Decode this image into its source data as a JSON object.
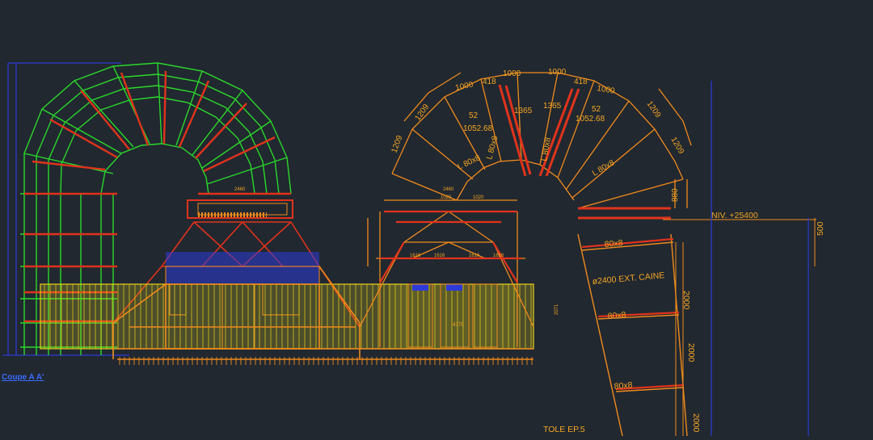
{
  "drawing": {
    "section_label": "Coupe A A'",
    "left_dims": [
      "880",
      "1209",
      "1209",
      "1000",
      "418",
      "1000",
      "1000",
      "418",
      "1000",
      "52",
      "1052.68",
      "1365",
      "1365",
      "52",
      "1052.68",
      "L 80x8",
      "L 80x8",
      "L 80x8",
      "L 80x8"
    ],
    "level_label": "NIV. +25400",
    "duct_labels": [
      "80x8",
      "ø2400 EXT. CAINE",
      "80x8",
      "80x8"
    ],
    "vertical_dims": [
      "500",
      "2000",
      "2000",
      "2000"
    ],
    "plate_label": "TOLE EP.5",
    "small_dims": [
      "1020",
      "2460",
      "1020",
      "2460",
      "1616",
      "1616",
      "1616",
      "1616",
      "2071",
      "4775"
    ],
    "colors": {
      "background": "#212830",
      "green": "#2bd82b",
      "orange": "#f08a1c",
      "yellow": "#e8d21c",
      "red": "#e0331c",
      "blue": "#2e3ad8",
      "label_blue": "#3b6cff",
      "dim_text": "#f5a623"
    }
  }
}
